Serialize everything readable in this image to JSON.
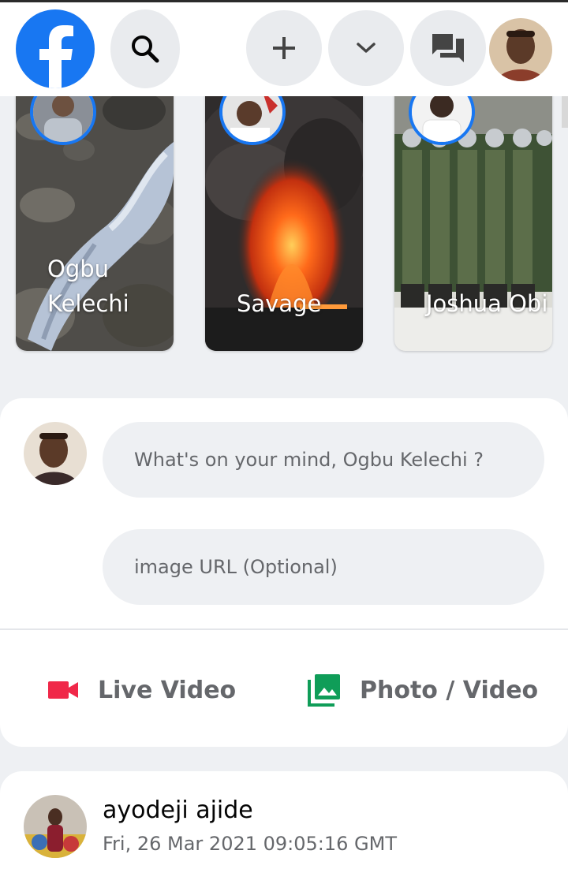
{
  "header": {
    "logo": "facebook-logo",
    "buttons": [
      {
        "icon": "search-icon"
      },
      {
        "icon": "plus-icon"
      },
      {
        "icon": "chevron-down-icon"
      },
      {
        "icon": "messenger-icon"
      }
    ]
  },
  "stories": [
    {
      "name": "Ogbu Kelechi"
    },
    {
      "name": "Savage"
    },
    {
      "name": "Joshua Obi"
    }
  ],
  "composer": {
    "status_placeholder": "What's on your mind, Ogbu Kelechi ?",
    "image_placeholder": "image URL (Optional)",
    "live_video_label": "Live Video",
    "photo_video_label": "Photo / Video"
  },
  "post": {
    "author": "ayodeji ajide",
    "timestamp": "Fri, 26 Mar 2021 09:05:16 GMT"
  },
  "colors": {
    "brand": "#1877f2",
    "live_video": "#f02849",
    "photo_video": "#0f9d58"
  }
}
